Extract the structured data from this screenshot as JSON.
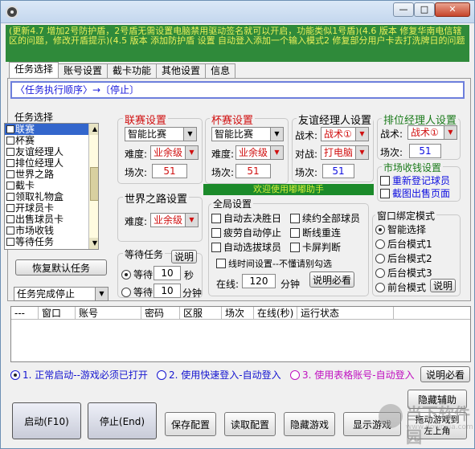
{
  "window": {
    "title": "",
    "min_glyph": "—",
    "max_glyph": "□",
    "close_glyph": "✕"
  },
  "notice": "(更新4.7 增加2号防护盾，2号盾无需设置电脑禁用驱动签名就可以开启，功能类似1号盾)(4.6 版本 修复华南电信辖区的问题，修改开盾提示)(4.5 版本 添加防护盾 设置 自动登入添加一个输入模式2 修复部分用户卡去打洗牌日的问题",
  "tabs": [
    "任务选择",
    "账号设置",
    "截卡功能",
    "其他设置",
    "信息"
  ],
  "sequence": "〈任务执行顺序〉→〔停止〕",
  "task_select": {
    "title": "任务选择",
    "items": [
      "联赛",
      "杯赛",
      "友谊经理人",
      "排位经理人",
      "世界之路",
      "截卡",
      "领取礼物盒",
      "开球员卡",
      "出售球员卡",
      "市场收钱",
      "等待任务"
    ],
    "selected_index": 0,
    "restore_button": "恢复默认任务",
    "after_complete": "任务完成停止"
  },
  "league": {
    "title": "联赛设置",
    "mode": "智能比赛",
    "difficulty_label": "难度:",
    "difficulty": "业余级",
    "rounds_label": "场次:",
    "rounds": "51"
  },
  "cup": {
    "title": "杯赛设置",
    "mode": "智能比赛",
    "difficulty_label": "难度:",
    "difficulty": "业余级",
    "rounds_label": "场次:",
    "rounds": "51"
  },
  "friendly": {
    "title": "友谊经理人设置",
    "tactic_label": "战术:",
    "tactic": "战术①",
    "opponent_label": "对战:",
    "opponent": "打电脑",
    "rounds_label": "场次:",
    "rounds": "51"
  },
  "ranked": {
    "title": "排位经理人设置",
    "tactic_label": "战术:",
    "tactic": "战术①",
    "rounds_label": "场次:",
    "rounds": "51"
  },
  "market": {
    "title": "市场收钱设置",
    "options": [
      "重新登记球员",
      "截图出售页面"
    ]
  },
  "world_road": {
    "title": "世界之路设置",
    "difficulty_label": "难度:",
    "difficulty": "业余级"
  },
  "banner": "欢迎使用嘟嘟助手",
  "global": {
    "title": "全局设置",
    "options": [
      "自动去决胜日",
      "续约全部球员",
      "疲劳自动停止",
      "断线重连",
      "自动选拔球员",
      "卡屏判断"
    ],
    "offline_label": "线时间设置--不懂请别勾选",
    "online_label": "在线:",
    "online_value": "120",
    "minutes_label": "分钟",
    "help_button": "说明必看"
  },
  "wait_task": {
    "title": "等待任务",
    "help_button": "说明",
    "wait_label": "等待",
    "seconds_value": "10",
    "seconds_unit": "秒",
    "minutes_value": "10",
    "minutes_unit": "分钟"
  },
  "window_bind": {
    "title": "窗口绑定模式",
    "options": [
      "智能选择",
      "后台模式1",
      "后台模式2",
      "后台模式3",
      "前台模式"
    ],
    "selected_index": 0,
    "help_button": "说明"
  },
  "grid": {
    "columns": [
      "---",
      "窗口",
      "账号",
      "密码",
      "区服",
      "场次",
      "在线(秒)",
      "运行状态"
    ]
  },
  "login_modes": {
    "options": [
      "1. 正常启动--游戏必须已打开",
      "2. 使用快速登入-自动登入",
      "3. 使用表格账号-自动登入"
    ],
    "selected_index": 0,
    "help_button": "说明必看"
  },
  "bottom": {
    "start": "启动(F10)",
    "stop": "停止(End)",
    "save": "保存配置",
    "load": "读取配置",
    "hide_game": "隐藏游戏",
    "show_game": "显示游戏",
    "hide_helper": "隐藏辅助",
    "drag_game": "拖动游戏到\n左上角"
  },
  "watermark": {
    "title": "当下软件园",
    "sub": "www.downxia.com"
  }
}
